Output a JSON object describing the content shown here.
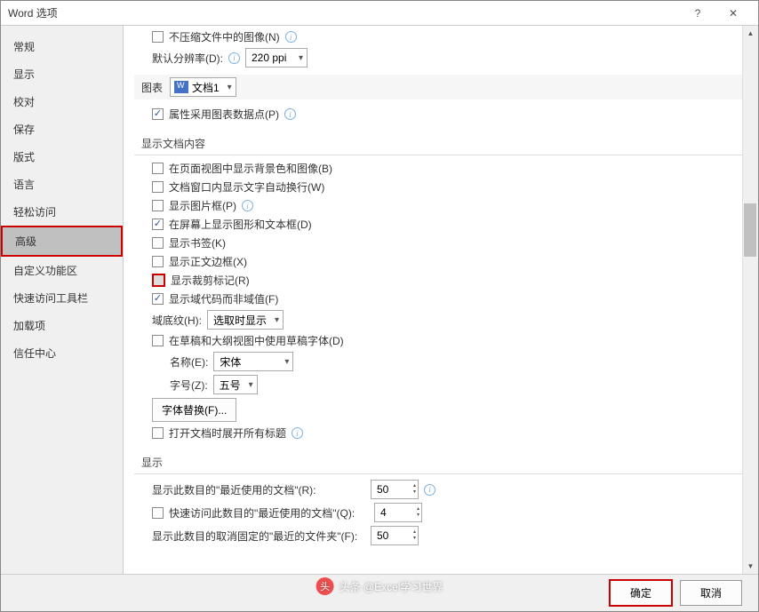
{
  "title": "Word 选项",
  "sidebar": {
    "items": [
      {
        "label": "常规"
      },
      {
        "label": "显示"
      },
      {
        "label": "校对"
      },
      {
        "label": "保存"
      },
      {
        "label": "版式"
      },
      {
        "label": "语言"
      },
      {
        "label": "轻松访问"
      },
      {
        "label": "高级",
        "selected": true
      },
      {
        "label": "自定义功能区"
      },
      {
        "label": "快速访问工具栏"
      },
      {
        "label": "加载项"
      },
      {
        "label": "信任中心"
      }
    ]
  },
  "top": {
    "opt1_label": "不压缩文件中的图像(N)",
    "res_label": "默认分辨率(D):",
    "res_value": "220 ppi"
  },
  "chart": {
    "label": "图表",
    "doc": "文档1",
    "prop": "属性采用图表数据点(P)"
  },
  "sectionA": {
    "hdr": "显示文档内容",
    "items": [
      {
        "label": "在页面视图中显示背景色和图像(B)",
        "checked": false
      },
      {
        "label": "文档窗口内显示文字自动换行(W)",
        "checked": false
      },
      {
        "label": "显示图片框(P)",
        "checked": false
      },
      {
        "label": "在屏幕上显示图形和文本框(D)",
        "checked": true
      },
      {
        "label": "显示书签(K)",
        "checked": false
      },
      {
        "label": "显示正文边框(X)",
        "checked": false
      },
      {
        "label": "显示裁剪标记(R)",
        "checked": false,
        "hl": true
      },
      {
        "label": "显示域代码而非域值(F)",
        "checked": true
      }
    ],
    "shade_label": "域底纹(H):",
    "shade_value": "选取时显示",
    "draft_label": "在草稿和大纲视图中使用草稿字体(D)",
    "name_label": "名称(E):",
    "name_value": "宋体",
    "fz_label": "字号(Z):",
    "fz_value": "五号",
    "sub_btn": "字体替换(F)...",
    "expand_label": "打开文档时展开所有标题"
  },
  "sectionB": {
    "hdr": "显示",
    "r1_label": "显示此数目的\"最近使用的文档\"(R):",
    "r1_value": "50",
    "r2_label": "快速访问此数目的\"最近使用的文档\"(Q):",
    "r2_value": "4",
    "r3_label": "显示此数目的取消固定的\"最近的文件夹\"(F):",
    "r3_value": "50"
  },
  "footer": {
    "ok": "确定",
    "cancel": "取消"
  },
  "watermark": "头条 @Excel学习世界"
}
